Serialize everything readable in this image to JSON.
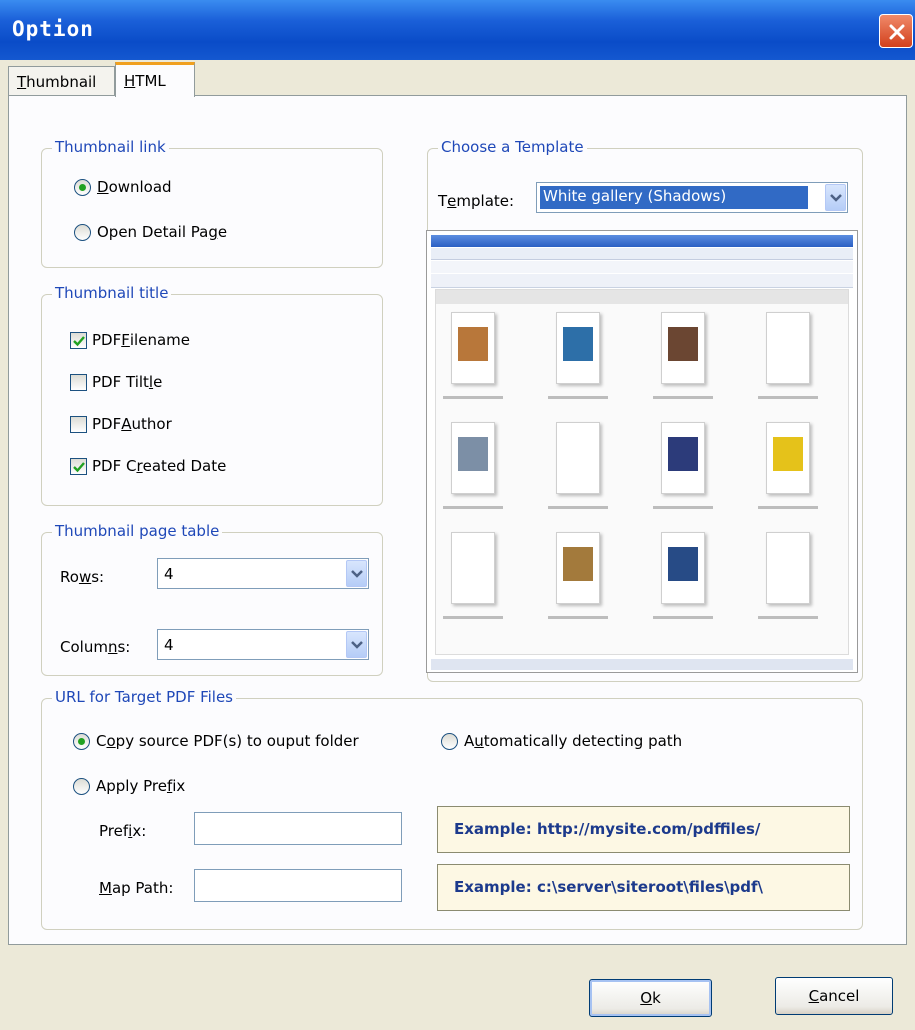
{
  "window": {
    "title": "Option"
  },
  "tabs": [
    {
      "label": "Thumbnail",
      "mnemonic": "T",
      "rest": "humbnail"
    },
    {
      "label": "HTML",
      "mnemonic": "H",
      "rest": "TML"
    }
  ],
  "thumbnail_link": {
    "label": "Thumbnail link",
    "options": [
      {
        "pre": "",
        "key": "D",
        "post": "ownload",
        "checked": true
      },
      {
        "pre": "Open Detail Pa",
        "key": "g",
        "post": "e",
        "checked": false
      }
    ]
  },
  "thumbnail_title": {
    "label": "Thumbnail title",
    "items": [
      {
        "pre": "PDF ",
        "key": "F",
        "post": "ilename",
        "checked": true
      },
      {
        "pre": "PDF Tilt",
        "key": "l",
        "post": "e",
        "checked": false
      },
      {
        "pre": "PDF ",
        "key": "A",
        "post": "uthor",
        "checked": false
      },
      {
        "pre": "PDF C",
        "key": "r",
        "post": "eated Date",
        "checked": true
      }
    ]
  },
  "page_table": {
    "label": "Thumbnail page table",
    "rows": {
      "pre": "Ro",
      "key": "w",
      "post": "s:",
      "value": "4"
    },
    "columns": {
      "pre": "Colum",
      "key": "n",
      "post": "s:",
      "value": "4"
    }
  },
  "template": {
    "group_label": "Choose a Template",
    "field_pre": "T",
    "field_key": "e",
    "field_post": "mplate:",
    "selected": "White gallery (Shadows)",
    "preview_thumbs": [
      {
        "row": 0,
        "col": 0,
        "color": "#b8773a"
      },
      {
        "row": 0,
        "col": 1,
        "color": "#2d6fa8"
      },
      {
        "row": 0,
        "col": 2,
        "color": "#6b4632"
      },
      {
        "row": 0,
        "col": 3,
        "color": "#ffffff"
      },
      {
        "row": 1,
        "col": 0,
        "color": "#7c8fa6"
      },
      {
        "row": 1,
        "col": 1,
        "color": "#ffffff"
      },
      {
        "row": 1,
        "col": 2,
        "color": "#2c3b7a"
      },
      {
        "row": 1,
        "col": 3,
        "color": "#e5c21a"
      },
      {
        "row": 2,
        "col": 0,
        "color": "#ffffff"
      },
      {
        "row": 2,
        "col": 1,
        "color": "#a37a3c"
      },
      {
        "row": 2,
        "col": 2,
        "color": "#274b86"
      },
      {
        "row": 2,
        "col": 3,
        "color": "#ffffff"
      }
    ]
  },
  "url_target": {
    "label": "URL for Target PDF Files",
    "copy": {
      "pre": "C",
      "key": "o",
      "post": "py source PDF(s) to ouput folder",
      "checked": true
    },
    "auto": {
      "pre": "A",
      "key": "u",
      "post": "tomatically detecting path",
      "checked": false
    },
    "prefix_radio": {
      "pre": "Apply Pre",
      "key": "f",
      "post": "ix",
      "checked": false
    },
    "prefix_field": {
      "pre": "Pref",
      "key": "i",
      "post": "x:",
      "value": ""
    },
    "map_field": {
      "pre": "",
      "key": "M",
      "post": "ap Path:",
      "value": ""
    },
    "example_prefix": "Example: http://mysite.com/pdffiles/",
    "example_map": "Example: c:\\server\\siteroot\\files\\pdf\\"
  },
  "buttons": {
    "ok": {
      "pre": "",
      "key": "O",
      "post": "k"
    },
    "cancel": {
      "pre": "",
      "key": "C",
      "post": "ancel"
    }
  }
}
